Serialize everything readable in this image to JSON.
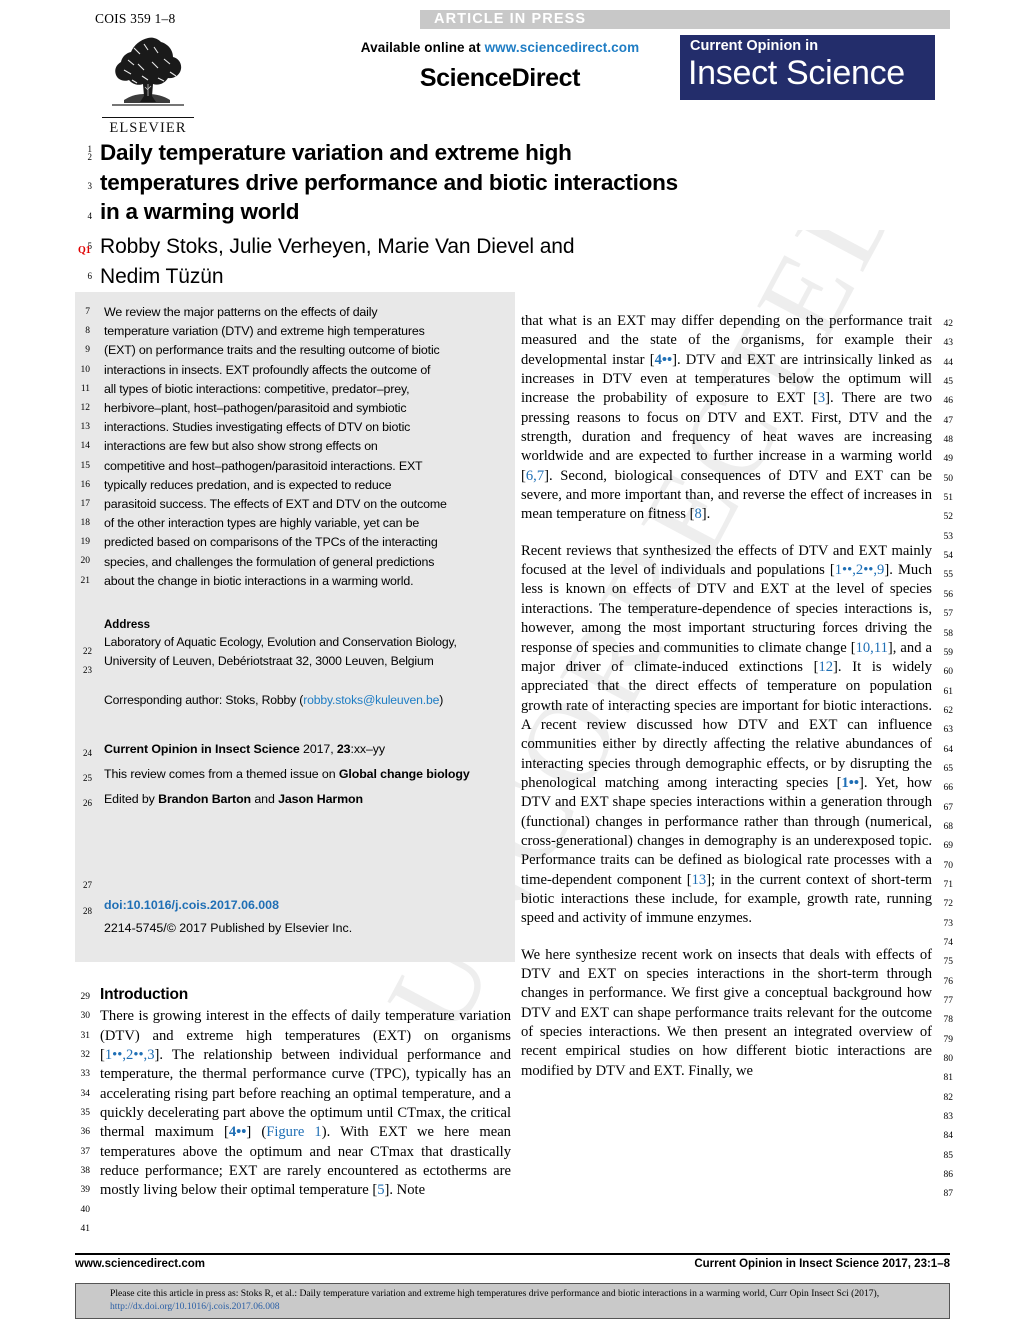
{
  "topbar": {
    "journal_code": "COIS 359 1–8",
    "status_banner": "ARTICLE IN PRESS"
  },
  "masthead": {
    "publisher": "ELSEVIER",
    "available_prefix": "Available online at ",
    "available_url": "www.sciencedirect.com",
    "sciencedirect_wordmark": "ScienceDirect",
    "journal_logo_top": "Current Opinion in",
    "journal_logo_bottom": "Insect Science"
  },
  "article": {
    "title_line_1": "Daily temperature variation and extreme high",
    "title_line_2": "temperatures drive performance and biotic interactions",
    "title_line_3": "in a warming world",
    "authors_line_1": "Robby Stoks, Julie Verheyen, Marie Van Dievel and",
    "authors_line_2": "Nedim Tüzün",
    "query_marker": "Q1"
  },
  "abstract": {
    "lines": [
      "We review the major patterns on the effects of daily",
      "temperature variation (DTV) and extreme high temperatures",
      "(EXT) on performance traits and the resulting outcome of biotic",
      "interactions in insects. EXT profoundly affects the outcome of",
      "all types of biotic interactions: competitive, predator–prey,",
      "herbivore–plant, host–pathogen/parasitoid and symbiotic",
      "interactions. Studies investigating effects of DTV on biotic",
      "interactions are few but also show strong effects on",
      "competitive and host–pathogen/parasitoid interactions. EXT",
      "typically reduces predation, and is expected to reduce",
      "parasitoid success. The effects of EXT and DTV on the outcome",
      "of the other interaction types are highly variable, yet can be",
      "predicted based on comparisons of the TPCs of the interacting",
      "species, and challenges the formulation of general predictions",
      "about the change in biotic interactions in a warming world."
    ]
  },
  "address": {
    "heading": "Address",
    "line_1": "Laboratory of Aquatic Ecology, Evolution and Conservation Biology,",
    "line_2": "University of Leuven, Debériotstraat 32, 3000 Leuven, Belgium",
    "corresponding_prefix": "Corresponding author: Stoks, Robby (",
    "corresponding_email": "robby.stoks@kuleuven.be",
    "corresponding_suffix": ")"
  },
  "journal_meta": {
    "citation_bold": "Current Opinion in Insect Science",
    "citation_rest": " 2017, ",
    "citation_volume": "23",
    "citation_pages": ":xx–yy",
    "themed_prefix": "This review comes from a themed issue on ",
    "themed_bold": "Global change biology",
    "edited_prefix": "Edited by ",
    "editor_1": "Brandon Barton",
    "edited_mid": " and ",
    "editor_2": "Jason Harmon",
    "doi": "doi:10.1016/j.cois.2017.06.008",
    "issn_copyright": "2214-5745/© 2017 Published by Elsevier Inc."
  },
  "sections": {
    "introduction_heading": "Introduction"
  },
  "line_numbers": {
    "title_block": [
      "1",
      "2",
      "3",
      "4",
      "5",
      "6"
    ],
    "abstract_start": 7,
    "abstract_end": 21,
    "address_nums": [
      "22",
      "23"
    ],
    "meta_nums": [
      "24",
      "25",
      "26"
    ],
    "doi_nums": [
      "27",
      "28"
    ],
    "left_col_start": 29,
    "left_col_end": 41,
    "right_col_start": 42,
    "right_col_end": 87
  },
  "body_left": {
    "paragraph_1_parts": [
      {
        "t": "There is growing interest in the effects of daily temperature variation (DTV) and extreme high temperatures (EXT) on organisms [",
        "k": "n"
      },
      {
        "t": "1••,2••,3",
        "k": "r"
      },
      {
        "t": "]. The relationship between individual performance and temperature, the thermal performance curve (TPC), typically has an accelerating rising part before reaching an optimal temperature, and a quickly decelerating part above the optimum until CTmax, the critical thermal maximum [",
        "k": "n"
      },
      {
        "t": "4••",
        "k": "rb"
      },
      {
        "t": "] (",
        "k": "n"
      },
      {
        "t": "Figure 1",
        "k": "r"
      },
      {
        "t": "). With EXT we here mean temperatures above the optimum and near CTmax that drastically reduce performance; EXT are rarely encountered as ectotherms are mostly living below their optimal temperature [",
        "k": "n"
      },
      {
        "t": "5",
        "k": "r"
      },
      {
        "t": "]. Note",
        "k": "n"
      }
    ]
  },
  "body_right": {
    "paragraph_1_parts": [
      {
        "t": "that what is an EXT may differ depending on the performance trait measured and the state of the organisms, for example their developmental instar [",
        "k": "n"
      },
      {
        "t": "4••",
        "k": "rb"
      },
      {
        "t": "]. DTV and EXT are intrinsically linked as increases in DTV even at temperatures below the optimum will increase the probability of exposure to EXT [",
        "k": "n"
      },
      {
        "t": "3",
        "k": "r"
      },
      {
        "t": "]. There are two pressing reasons to focus on DTV and EXT. First, DTV and the strength, duration and frequency of heat waves are increasing worldwide and are expected to further increase in a warming world [",
        "k": "n"
      },
      {
        "t": "6,7",
        "k": "r"
      },
      {
        "t": "]. Second, biological consequences of DTV and EXT can be severe, and more important than, and reverse the effect of increases in mean temperature on fitness [",
        "k": "n"
      },
      {
        "t": "8",
        "k": "r"
      },
      {
        "t": "].",
        "k": "n"
      }
    ],
    "paragraph_2_parts": [
      {
        "t": "Recent reviews that synthesized the effects of DTV and EXT mainly focused at the level of individuals and populations [",
        "k": "n"
      },
      {
        "t": "1••,2••,9",
        "k": "r"
      },
      {
        "t": "]. Much less is known on effects of DTV and EXT at the level of species interactions. The temperature-dependence of species interactions is, however, among the most important structuring forces driving the response of species and communities to climate change [",
        "k": "n"
      },
      {
        "t": "10,11",
        "k": "r"
      },
      {
        "t": "], and a major driver of climate-induced extinctions [",
        "k": "n"
      },
      {
        "t": "12",
        "k": "r"
      },
      {
        "t": "]. It is widely appreciated that the direct effects of temperature on population growth rate of interacting species are important for biotic interactions. A recent review discussed how DTV and EXT can influence communities either by directly affecting the relative abundances of interacting species through demographic effects, or by disrupting the phenological matching among interacting species [",
        "k": "n"
      },
      {
        "t": "1••",
        "k": "rb"
      },
      {
        "t": "]. Yet, how DTV and EXT shape species interactions within a generation through (functional) changes in performance rather than through (numerical, cross-generational) changes in demography is an underexposed topic. Performance traits can be defined as biological rate processes with a time-dependent component [",
        "k": "n"
      },
      {
        "t": "13",
        "k": "r"
      },
      {
        "t": "]; in the current context of short-term biotic interactions these include, for example, growth rate, running speed and activity of immune enzymes.",
        "k": "n"
      }
    ],
    "paragraph_3_parts": [
      {
        "t": "We here synthesize recent work on insects that deals with effects of DTV and EXT on species interactions in the short-term through changes in performance. We first give a conceptual background how DTV and EXT can shape performance traits relevant for the outcome of species interactions. We then present an integrated overview of recent empirical studies on how different biotic interactions are modified by DTV and EXT. Finally, we",
        "k": "n"
      }
    ]
  },
  "footer": {
    "left": "www.sciencedirect.com",
    "right": "Current Opinion in Insect Science 2017, 23:1–8",
    "cite_line_1": "Please cite this article in press as: Stoks R, et al.: Daily temperature variation and extreme high temperatures drive performance and biotic interactions in a warming world, Curr Opin Insect Sci",
    "cite_line_2_prefix": "(2017), ",
    "cite_line_2_link": "http://dx.doi.org/10.1016/j.cois.2017.06.008"
  },
  "watermark": {
    "text": "UNCORRECTED PROOF"
  },
  "colors": {
    "banner_gray": "#c8c8c8",
    "panel_gray": "#e8e8e8",
    "link_blue": "#1f7dc4",
    "ref_blue": "#1f6fb5",
    "journal_navy": "#232d6b",
    "query_red": "#e00000",
    "cite_box_gray": "#c9c9c9"
  }
}
